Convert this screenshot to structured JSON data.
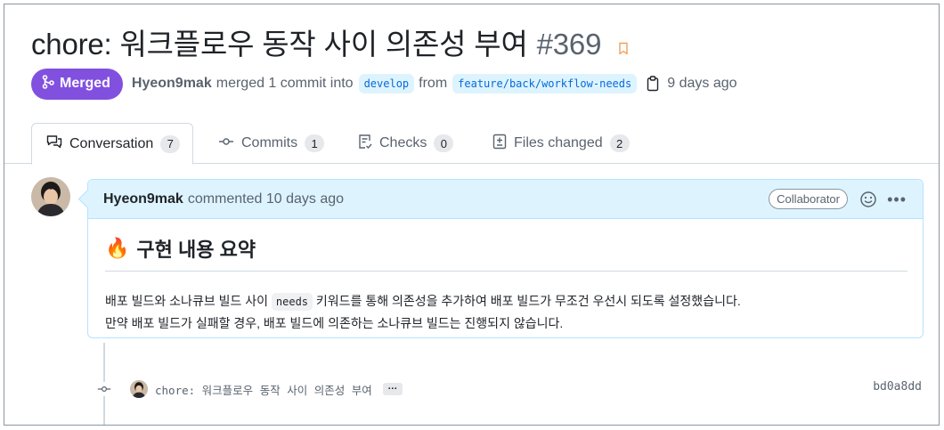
{
  "pr": {
    "title": "chore: 워크플로우 동작 사이 의존성 부여",
    "number": "#369"
  },
  "meta": {
    "status": "Merged",
    "author": "Hyeon9mak",
    "merged_text": "merged 1 commit into",
    "base_branch": "develop",
    "from_text": "from",
    "head_branch": "feature/back/workflow-needs",
    "time_ago": "9 days ago"
  },
  "tabs": [
    {
      "label": "Conversation",
      "count": "7",
      "icon": "conversation-icon",
      "active": true
    },
    {
      "label": "Commits",
      "count": "1",
      "icon": "commit-icon",
      "active": false
    },
    {
      "label": "Checks",
      "count": "0",
      "icon": "checklist-icon",
      "active": false
    },
    {
      "label": "Files changed",
      "count": "2",
      "icon": "diff-icon",
      "active": false
    }
  ],
  "comment": {
    "author": "Hyeon9mak",
    "action": "commented 10 days ago",
    "role": "Collaborator",
    "heading_emoji": "🔥",
    "heading": "구현 내용 요약",
    "line1_before": "배포 빌드와 소나큐브 빌드 사이",
    "line1_code": "needs",
    "line1_after": "키워드를 통해 의존성을 추가하여 배포 빌드가 무조건 우선시 되도록 설정했습니다.",
    "line2": "만약 배포 빌드가 실패할 경우, 배포 빌드에 의존하는 소나큐브 빌드는 진행되지 않습니다."
  },
  "commit": {
    "message": "chore: 워크플로우 동작 사이 의존성 부여",
    "more": "…",
    "sha": "bd0a8dd"
  },
  "colors": {
    "merged": "#8250df",
    "link": "#0969da",
    "comment_header": "#ddf4ff"
  }
}
